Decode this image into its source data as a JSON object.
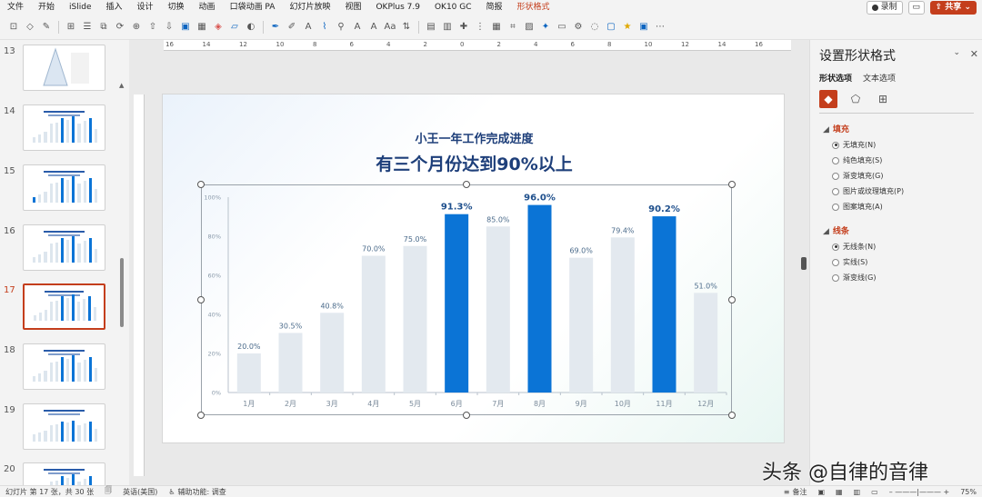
{
  "menubar": {
    "items": [
      "文件",
      "开始",
      "iSlide",
      "插入",
      "设计",
      "切换",
      "动画",
      "口袋动画 PA",
      "幻灯片放映",
      "视图",
      "OKPlus 7.9",
      "OK10 GC",
      "简报",
      "形状格式"
    ],
    "active_index": 13,
    "record_label": "录制",
    "share_label": "共享"
  },
  "thumbs": [
    {
      "num": "13",
      "type": "triangle"
    },
    {
      "num": "14",
      "type": "bars"
    },
    {
      "num": "15",
      "type": "bars2"
    },
    {
      "num": "16",
      "type": "spikes"
    },
    {
      "num": "17",
      "type": "bars",
      "selected": true
    },
    {
      "num": "18",
      "type": "bars"
    },
    {
      "num": "19",
      "type": "bars3"
    },
    {
      "num": "20",
      "type": "bars"
    }
  ],
  "ruler_labels": [
    "16",
    "14",
    "12",
    "10",
    "8",
    "6",
    "4",
    "2",
    "0",
    "2",
    "4",
    "6",
    "8",
    "10",
    "12",
    "14",
    "16"
  ],
  "slide": {
    "subtitle": "小王一年工作完成进度",
    "title": "有三个月份达到90%以上"
  },
  "chart_data": {
    "type": "bar",
    "categories": [
      "1月",
      "2月",
      "3月",
      "4月",
      "5月",
      "6月",
      "7月",
      "8月",
      "9月",
      "10月",
      "11月",
      "12月"
    ],
    "values": [
      20.0,
      30.5,
      40.8,
      70.0,
      75.0,
      91.3,
      85.0,
      96.0,
      69.0,
      79.4,
      90.2,
      51.0
    ],
    "value_labels": [
      "20.0%",
      "30.5%",
      "40.8%",
      "70.0%",
      "75.0%",
      "91.3%",
      "85.0%",
      "96.0%",
      "69.0%",
      "79.4%",
      "90.2%",
      "51.0%"
    ],
    "highlight": [
      false,
      false,
      false,
      false,
      false,
      true,
      false,
      true,
      false,
      false,
      true,
      false
    ],
    "yticks": [
      "0%",
      "20%",
      "40%",
      "60%",
      "80%",
      "100%"
    ],
    "ylim": [
      0,
      100
    ],
    "colors": {
      "normal": "#e3e9ef",
      "highlight": "#0b74d6",
      "label": "#4a6a8a",
      "label_highlight": "#1e4f8c"
    },
    "grid": false
  },
  "format_pane": {
    "title": "设置形状格式",
    "tabs": [
      "形状选项",
      "文本选项"
    ],
    "fill_section": "填充",
    "fill_options": [
      {
        "label": "无填充(N)",
        "checked": true
      },
      {
        "label": "纯色填充(S)",
        "checked": false
      },
      {
        "label": "渐变填充(G)",
        "checked": false
      },
      {
        "label": "图片或纹理填充(P)",
        "checked": false
      },
      {
        "label": "图案填充(A)",
        "checked": false
      }
    ],
    "line_section": "线条",
    "line_options": [
      {
        "label": "无线条(N)",
        "checked": true
      },
      {
        "label": "实线(S)",
        "checked": false
      },
      {
        "label": "渐变线(G)",
        "checked": false
      }
    ]
  },
  "statusbar": {
    "slide_info": "幻灯片 第 17 张，共 30 张",
    "language": "英语(美国)",
    "accessibility": "辅助功能: 调查",
    "notes": "备注",
    "zoom": "75%"
  },
  "watermark": "头条 @自律的音律"
}
